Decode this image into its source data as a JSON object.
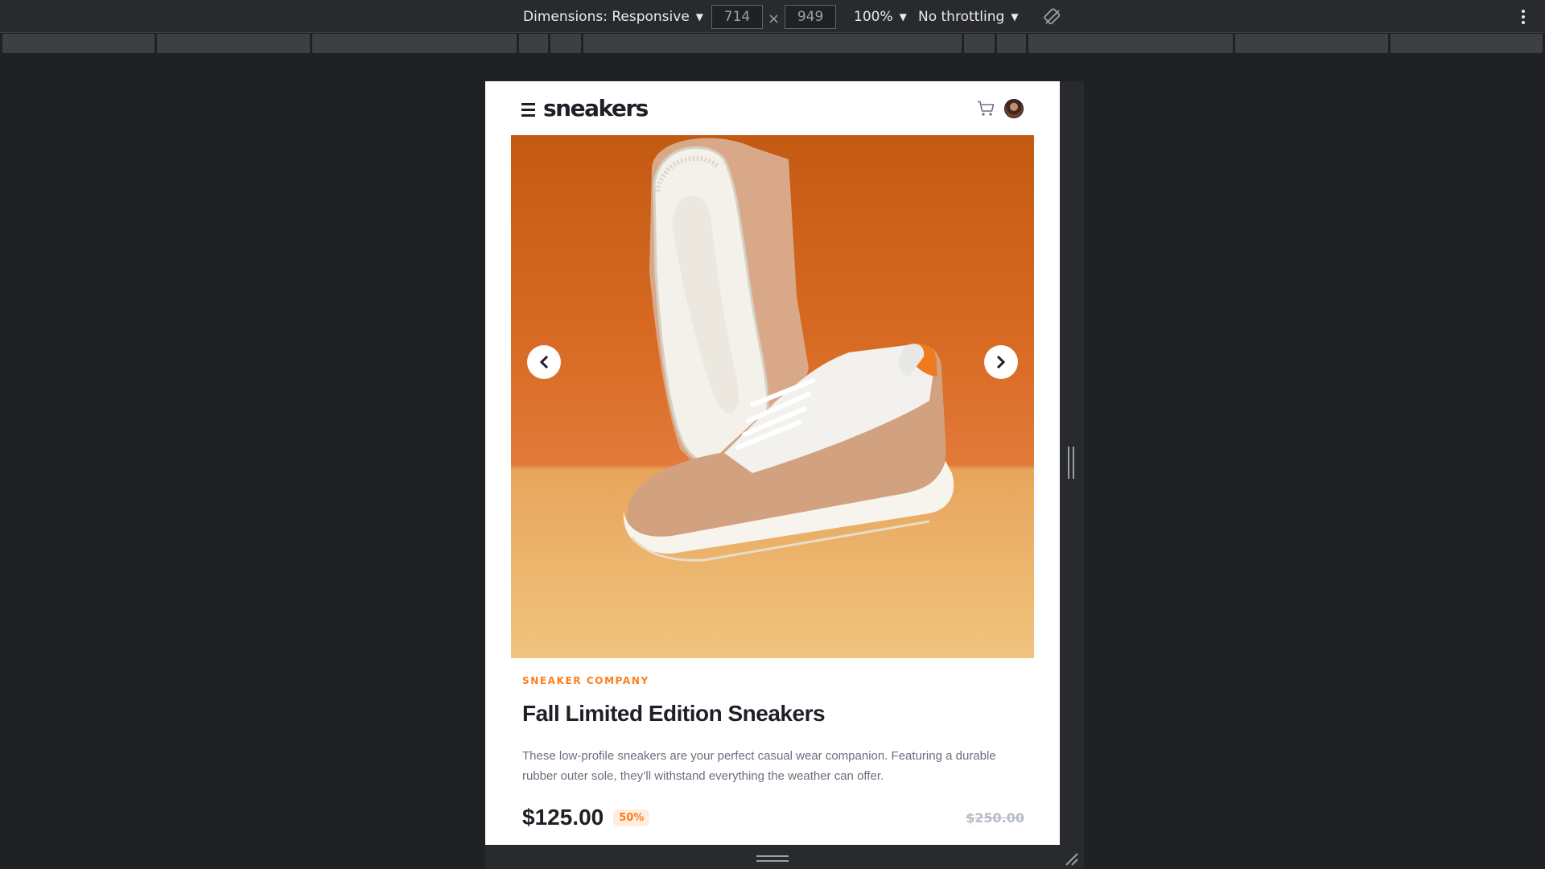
{
  "devtools": {
    "dimensions_label": "Dimensions: Responsive",
    "width_value": "714",
    "height_value": "949",
    "times_symbol": "×",
    "zoom": "100%",
    "throttling": "No throttling"
  },
  "site": {
    "logo": "sneakers",
    "company": "SNEAKER COMPANY",
    "title": "Fall Limited Edition Sneakers",
    "description": "These low-profile sneakers are your perfect casual wear companion. Featuring a durable rubber outer sole, they’ll withstand everything the weather can offer.",
    "price": "$125.00",
    "discount": "50%",
    "original_price": "$250.00"
  },
  "colors": {
    "accent": "#ff7d1a",
    "accent_pale": "#ffede0",
    "dark": "#1d2026",
    "muted": "#68707d"
  },
  "icons": {
    "menu": "menu-icon",
    "cart": "cart-icon",
    "avatar": "avatar",
    "previous": "chevron-left-icon",
    "next": "chevron-right-icon",
    "rotate": "rotate-icon",
    "more": "more-vertical-icon"
  }
}
